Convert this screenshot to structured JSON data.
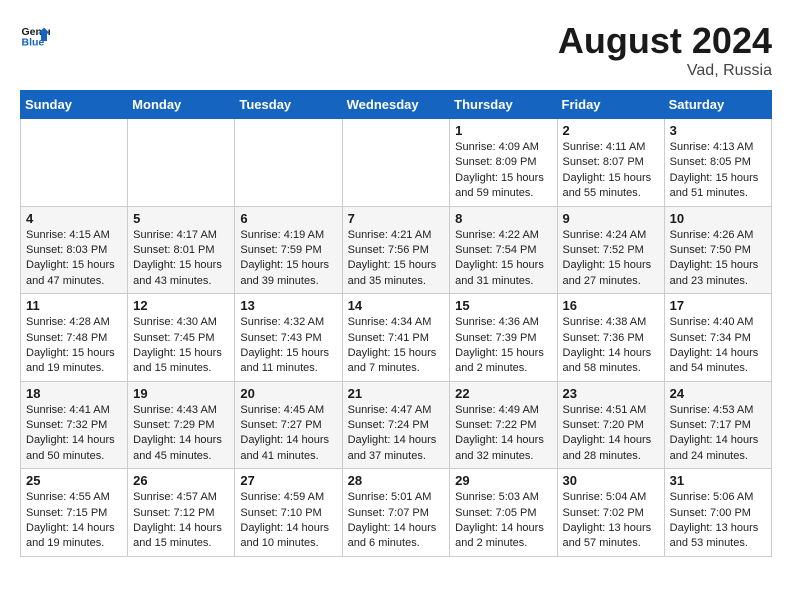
{
  "header": {
    "logo_line1": "General",
    "logo_line2": "Blue",
    "month_year": "August 2024",
    "location": "Vad, Russia"
  },
  "days_of_week": [
    "Sunday",
    "Monday",
    "Tuesday",
    "Wednesday",
    "Thursday",
    "Friday",
    "Saturday"
  ],
  "weeks": [
    [
      {
        "day": "",
        "info": ""
      },
      {
        "day": "",
        "info": ""
      },
      {
        "day": "",
        "info": ""
      },
      {
        "day": "",
        "info": ""
      },
      {
        "day": "1",
        "info": "Sunrise: 4:09 AM\nSunset: 8:09 PM\nDaylight: 15 hours\nand 59 minutes."
      },
      {
        "day": "2",
        "info": "Sunrise: 4:11 AM\nSunset: 8:07 PM\nDaylight: 15 hours\nand 55 minutes."
      },
      {
        "day": "3",
        "info": "Sunrise: 4:13 AM\nSunset: 8:05 PM\nDaylight: 15 hours\nand 51 minutes."
      }
    ],
    [
      {
        "day": "4",
        "info": "Sunrise: 4:15 AM\nSunset: 8:03 PM\nDaylight: 15 hours\nand 47 minutes."
      },
      {
        "day": "5",
        "info": "Sunrise: 4:17 AM\nSunset: 8:01 PM\nDaylight: 15 hours\nand 43 minutes."
      },
      {
        "day": "6",
        "info": "Sunrise: 4:19 AM\nSunset: 7:59 PM\nDaylight: 15 hours\nand 39 minutes."
      },
      {
        "day": "7",
        "info": "Sunrise: 4:21 AM\nSunset: 7:56 PM\nDaylight: 15 hours\nand 35 minutes."
      },
      {
        "day": "8",
        "info": "Sunrise: 4:22 AM\nSunset: 7:54 PM\nDaylight: 15 hours\nand 31 minutes."
      },
      {
        "day": "9",
        "info": "Sunrise: 4:24 AM\nSunset: 7:52 PM\nDaylight: 15 hours\nand 27 minutes."
      },
      {
        "day": "10",
        "info": "Sunrise: 4:26 AM\nSunset: 7:50 PM\nDaylight: 15 hours\nand 23 minutes."
      }
    ],
    [
      {
        "day": "11",
        "info": "Sunrise: 4:28 AM\nSunset: 7:48 PM\nDaylight: 15 hours\nand 19 minutes."
      },
      {
        "day": "12",
        "info": "Sunrise: 4:30 AM\nSunset: 7:45 PM\nDaylight: 15 hours\nand 15 minutes."
      },
      {
        "day": "13",
        "info": "Sunrise: 4:32 AM\nSunset: 7:43 PM\nDaylight: 15 hours\nand 11 minutes."
      },
      {
        "day": "14",
        "info": "Sunrise: 4:34 AM\nSunset: 7:41 PM\nDaylight: 15 hours\nand 7 minutes."
      },
      {
        "day": "15",
        "info": "Sunrise: 4:36 AM\nSunset: 7:39 PM\nDaylight: 15 hours\nand 2 minutes."
      },
      {
        "day": "16",
        "info": "Sunrise: 4:38 AM\nSunset: 7:36 PM\nDaylight: 14 hours\nand 58 minutes."
      },
      {
        "day": "17",
        "info": "Sunrise: 4:40 AM\nSunset: 7:34 PM\nDaylight: 14 hours\nand 54 minutes."
      }
    ],
    [
      {
        "day": "18",
        "info": "Sunrise: 4:41 AM\nSunset: 7:32 PM\nDaylight: 14 hours\nand 50 minutes."
      },
      {
        "day": "19",
        "info": "Sunrise: 4:43 AM\nSunset: 7:29 PM\nDaylight: 14 hours\nand 45 minutes."
      },
      {
        "day": "20",
        "info": "Sunrise: 4:45 AM\nSunset: 7:27 PM\nDaylight: 14 hours\nand 41 minutes."
      },
      {
        "day": "21",
        "info": "Sunrise: 4:47 AM\nSunset: 7:24 PM\nDaylight: 14 hours\nand 37 minutes."
      },
      {
        "day": "22",
        "info": "Sunrise: 4:49 AM\nSunset: 7:22 PM\nDaylight: 14 hours\nand 32 minutes."
      },
      {
        "day": "23",
        "info": "Sunrise: 4:51 AM\nSunset: 7:20 PM\nDaylight: 14 hours\nand 28 minutes."
      },
      {
        "day": "24",
        "info": "Sunrise: 4:53 AM\nSunset: 7:17 PM\nDaylight: 14 hours\nand 24 minutes."
      }
    ],
    [
      {
        "day": "25",
        "info": "Sunrise: 4:55 AM\nSunset: 7:15 PM\nDaylight: 14 hours\nand 19 minutes."
      },
      {
        "day": "26",
        "info": "Sunrise: 4:57 AM\nSunset: 7:12 PM\nDaylight: 14 hours\nand 15 minutes."
      },
      {
        "day": "27",
        "info": "Sunrise: 4:59 AM\nSunset: 7:10 PM\nDaylight: 14 hours\nand 10 minutes."
      },
      {
        "day": "28",
        "info": "Sunrise: 5:01 AM\nSunset: 7:07 PM\nDaylight: 14 hours\nand 6 minutes."
      },
      {
        "day": "29",
        "info": "Sunrise: 5:03 AM\nSunset: 7:05 PM\nDaylight: 14 hours\nand 2 minutes."
      },
      {
        "day": "30",
        "info": "Sunrise: 5:04 AM\nSunset: 7:02 PM\nDaylight: 13 hours\nand 57 minutes."
      },
      {
        "day": "31",
        "info": "Sunrise: 5:06 AM\nSunset: 7:00 PM\nDaylight: 13 hours\nand 53 minutes."
      }
    ]
  ]
}
